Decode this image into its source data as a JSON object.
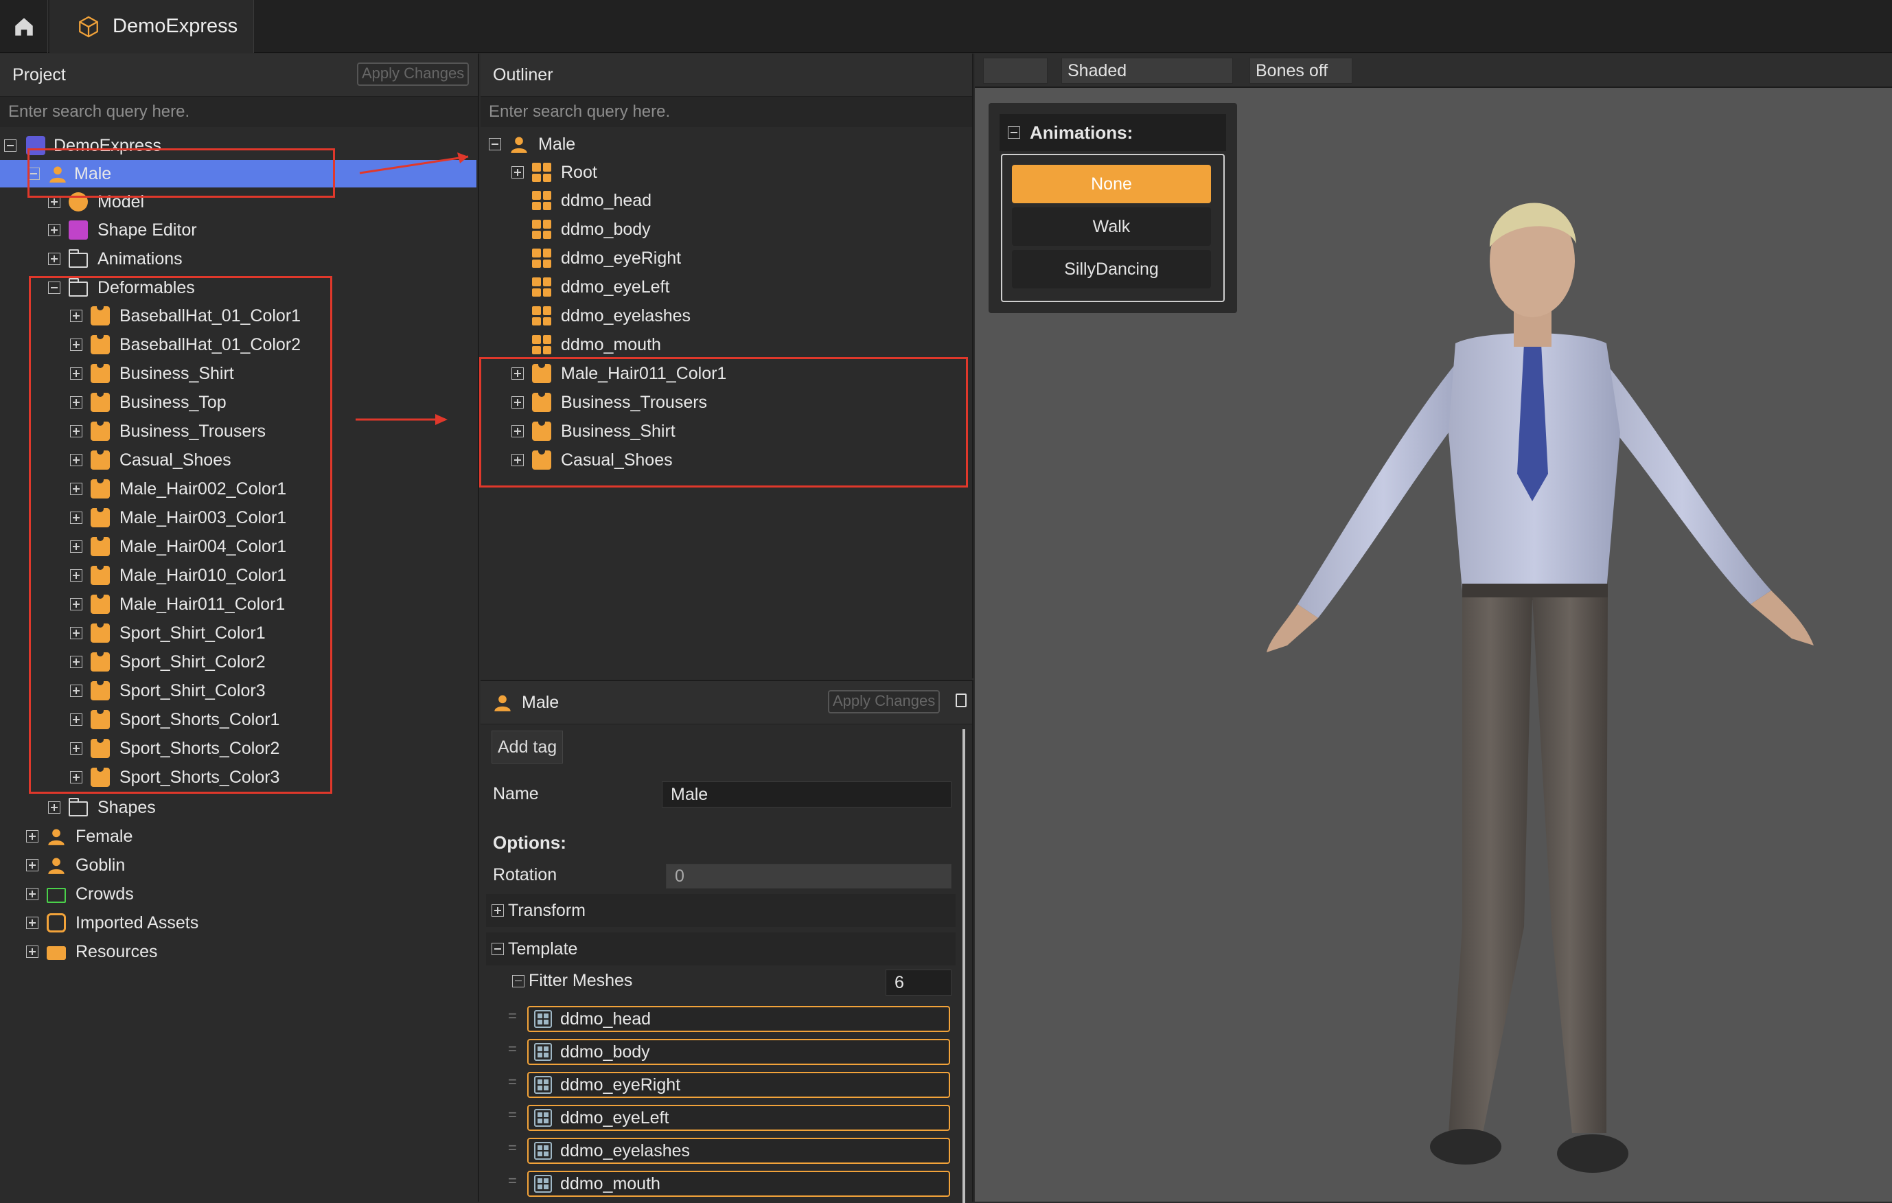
{
  "topbar": {
    "tab_label": "DemoExpress"
  },
  "project": {
    "title": "Project",
    "apply_label": "Apply Changes",
    "search_placeholder": "Enter search query here.",
    "root": "DemoExpress",
    "selected": "Male",
    "male_children": [
      "Model",
      "Shape Editor",
      "Animations",
      "Deformables"
    ],
    "deformables": [
      "BaseballHat_01_Color1",
      "BaseballHat_01_Color2",
      "Business_Shirt",
      "Business_Top",
      "Business_Trousers",
      "Casual_Shoes",
      "Male_Hair002_Color1",
      "Male_Hair003_Color1",
      "Male_Hair004_Color1",
      "Male_Hair010_Color1",
      "Male_Hair011_Color1",
      "Sport_Shirt_Color1",
      "Sport_Shirt_Color2",
      "Sport_Shirt_Color3",
      "Sport_Shorts_Color1",
      "Sport_Shorts_Color2",
      "Sport_Shorts_Color3"
    ],
    "shapes": "Shapes",
    "roots": [
      "Female",
      "Goblin",
      "Crowds",
      "Imported Assets",
      "Resources"
    ]
  },
  "outliner": {
    "title": "Outliner",
    "search_placeholder": "Enter search query here.",
    "root": "Male",
    "root_child": "Root",
    "meshes": [
      "ddmo_head",
      "ddmo_body",
      "ddmo_eyeRight",
      "ddmo_eyeLeft",
      "ddmo_eyelashes",
      "ddmo_mouth"
    ],
    "deformables": [
      "Male_Hair011_Color1",
      "Business_Trousers",
      "Business_Shirt",
      "Casual_Shoes"
    ]
  },
  "inspector": {
    "title": "Male",
    "apply_label": "Apply Changes",
    "add_tag": "Add tag",
    "name_label": "Name",
    "name_value": "Male",
    "options_label": "Options:",
    "rotation_label": "Rotation",
    "rotation_value": "0",
    "transform_label": "Transform",
    "template_label": "Template",
    "fitter_label": "Fitter Meshes",
    "fitter_count": "6",
    "fitter_meshes": [
      "ddmo_head",
      "ddmo_body",
      "ddmo_eyeRight",
      "ddmo_eyeLeft",
      "ddmo_eyelashes",
      "ddmo_mouth"
    ]
  },
  "viewport": {
    "shading": "Shaded",
    "bones": "Bones off",
    "animations_title": "Animations:",
    "animations": [
      "None",
      "Walk",
      "SillyDancing"
    ],
    "active_animation": "None"
  },
  "colors": {
    "accent": "#f2a33a",
    "selection": "#5b7ce8",
    "annotation": "#e0382b"
  }
}
